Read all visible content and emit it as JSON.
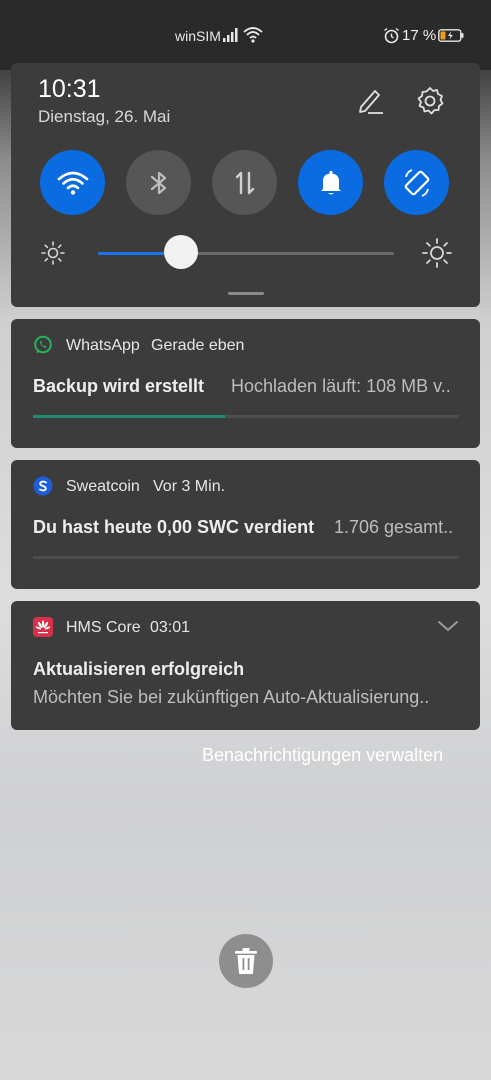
{
  "status_bar": {
    "carrier": "winSIM",
    "battery_percent": "17 %"
  },
  "quick_settings": {
    "time": "10:31",
    "date": "Dienstag, 26. Mai",
    "toggles": [
      {
        "name": "wifi",
        "state": "on"
      },
      {
        "name": "bluetooth",
        "state": "off"
      },
      {
        "name": "mobile-data",
        "state": "off"
      },
      {
        "name": "notification-bell",
        "state": "on"
      },
      {
        "name": "auto-rotate",
        "state": "on"
      }
    ],
    "brightness_level": 0.28,
    "accent_color": "#0a6ce0"
  },
  "notifications": [
    {
      "app": "WhatsApp",
      "time": "Gerade eben",
      "title": "Backup wird erstellt",
      "detail": "Hochladen läuft: 108 MB v..",
      "progress": 0.45,
      "icon_color": "#25b35a"
    },
    {
      "app": "Sweatcoin",
      "time": "Vor 3 Min.",
      "title": "Du hast heute 0,00 SWC verdient",
      "detail": "1.706 gesamt..",
      "icon_color": "#1f5ed8"
    },
    {
      "app": "HMS Core",
      "time": "03:01",
      "title": "Aktualisieren erfolgreich",
      "body": "Möchten Sie bei zukünftigen Auto-Aktualisierung..",
      "icon_color": "#d8304a"
    }
  ],
  "manage_link": "Benachrichtigungen verwalten"
}
